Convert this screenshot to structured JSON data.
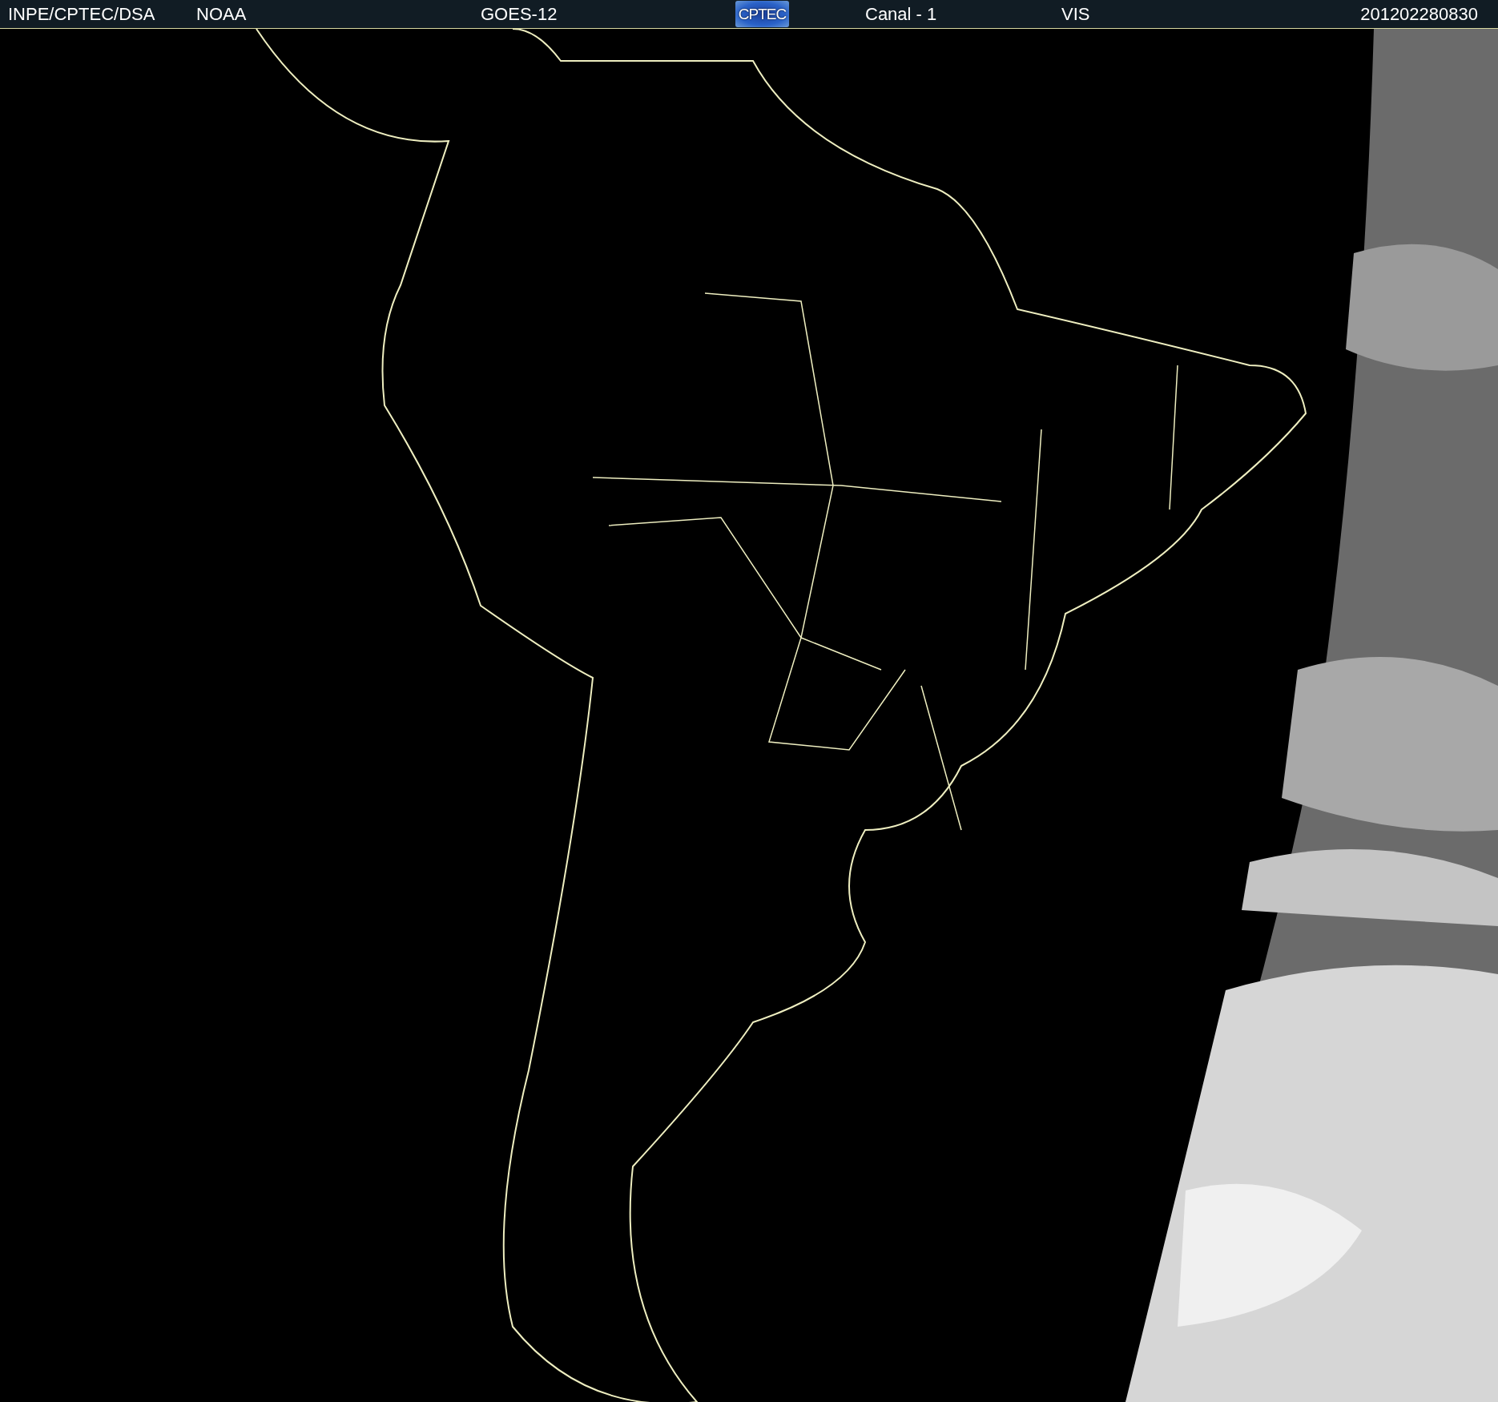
{
  "header": {
    "source": "INPE/CPTEC/DSA",
    "agency": "NOAA",
    "satellite": "GOES-12",
    "logo": "CPTEC",
    "channel": "Canal - 1",
    "band": "VIS",
    "timestamp": "201202280830"
  }
}
